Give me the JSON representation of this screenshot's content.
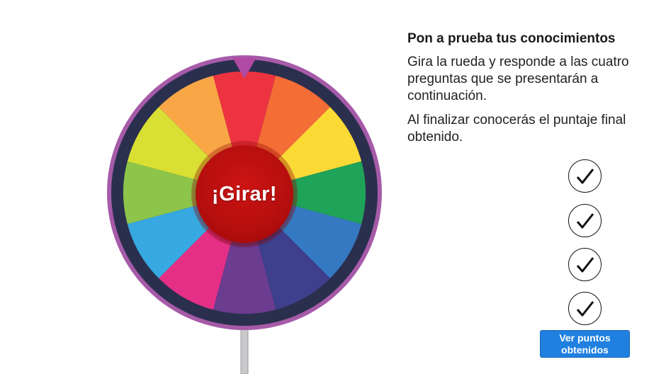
{
  "wheel": {
    "spin_label": "¡Girar!",
    "segment_colors": [
      "#ed3340",
      "#f46d35",
      "#fbda36",
      "#1fa358",
      "#3479c2",
      "#3e3f8d",
      "#6b3c90",
      "#e52f87",
      "#37a8e0",
      "#8cc54a",
      "#d9e033",
      "#f9a646"
    ],
    "rim_color": "#2b2f4e",
    "outer_ring_color": "#a65ba8",
    "pointer_color": "#b04ba5"
  },
  "panel": {
    "title": "Pon a prueba tus conocimientos",
    "instructions": "Gira la rueda y responde a las cuatro preguntas que se presentarán a continuación.",
    "final_note": "Al finalizar conocerás el puntaje final obtenido."
  },
  "checkmarks": [
    {
      "icon": "check-icon",
      "checked": true
    },
    {
      "icon": "check-icon",
      "checked": true
    },
    {
      "icon": "check-icon",
      "checked": true
    },
    {
      "icon": "check-icon",
      "checked": true
    }
  ],
  "results_button_label": "Ver puntos obtenidos",
  "colors": {
    "accent": "#1f80e0",
    "spin_button": "#b50e0e"
  }
}
